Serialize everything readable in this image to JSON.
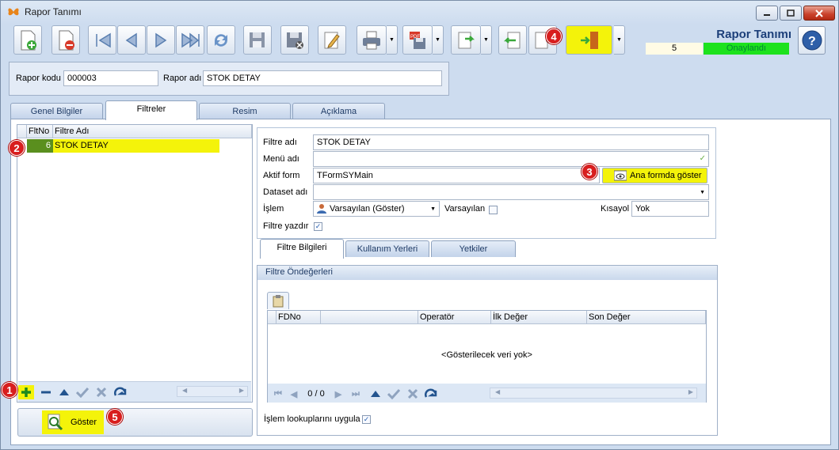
{
  "window": {
    "title": "Rapor Tanımı"
  },
  "header": {
    "title": "Rapor Tanımı",
    "count": "5",
    "status": "Onaylandı"
  },
  "badges": [
    "1",
    "2",
    "3",
    "4",
    "5"
  ],
  "form": {
    "rapor_kodu_label": "Rapor kodu",
    "rapor_kodu_value": "000003",
    "rapor_adi_label": "Rapor adı",
    "rapor_adi_value": "STOK DETAY"
  },
  "tabs": [
    "Genel Bilgiler",
    "Filtreler",
    "Resim",
    "Açıklama"
  ],
  "filters_grid": {
    "columns": [
      "FltNo",
      "Filtre Adı"
    ],
    "rows": [
      {
        "no": "6",
        "name": "STOK DETAY"
      }
    ]
  },
  "goster_label": "Göster",
  "filter_detail": {
    "filtre_adi_label": "Filtre adı",
    "filtre_adi_value": "STOK DETAY",
    "menu_adi_label": "Menü adı",
    "aktif_form_label": "Aktif form",
    "aktif_form_value": "TFormSYMain",
    "ana_form_button": "Ana formda göster",
    "dataset_label": "Dataset adı",
    "islem_label": "İşlem",
    "islem_value": "Varsayılan (Göster)",
    "varsayilan_label": "Varsayılan",
    "kisayol_label": "Kısayol",
    "kisayol_value": "Yok",
    "filtre_yazdir_label": "Filtre yazdır"
  },
  "sub_tabs": [
    "Filtre Bilgileri",
    "Kullanım Yerleri",
    "Yetkiler"
  ],
  "ondegerler": {
    "title": "Filtre Öndeğerleri",
    "columns": [
      "FDNo",
      "",
      "Operatör",
      "İlk Değer",
      "Son Değer"
    ],
    "empty_text": "<Gösterilecek veri yok>",
    "record_counter": "0 / 0"
  },
  "lookup_label": "İşlem lookuplarını uygula",
  "colors": {
    "highlight": "#f4f30a",
    "status_green": "#1de21d",
    "badge_red": "#d81e1e"
  }
}
